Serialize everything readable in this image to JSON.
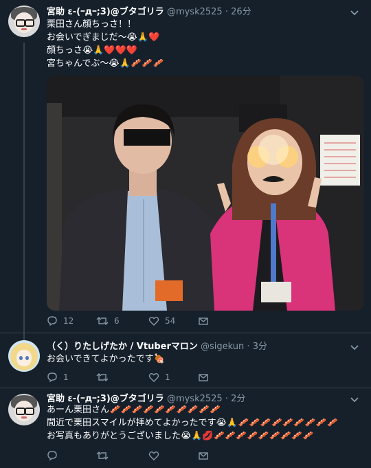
{
  "tweets": [
    {
      "name": "宮助 ε-(ｰдｰ;3)@ブタゴリラ",
      "handle": "@mysk2525",
      "sep": "·",
      "time": "26分",
      "lines": [
        "栗田さん顔ちっさ！！",
        "お会いでぎまじだ〜😭🙏❤️",
        "顔ちっさ😭🙏❤️❤️❤️",
        "宮ちゃんでぶ〜😭🙏🥓🥓🥓"
      ],
      "reply_count": "12",
      "retweet_count": "6",
      "like_count": "54"
    },
    {
      "name": "（く）りたしげたか / Vtuberマロン",
      "handle": "@sigekun",
      "sep": "·",
      "time": "3分",
      "lines": [
        "お会いできてよかったです🍖"
      ],
      "reply_count": "1",
      "retweet_count": "",
      "like_count": "1"
    },
    {
      "name": "宮助 ε-(ｰдｰ;3)@ブタゴリラ",
      "handle": "@mysk2525",
      "sep": "·",
      "time": "2分",
      "lines": [
        "あーん栗田さん🥓🥓🥓🥓🥓🥓🥓🥓🥓🥓",
        "間近で栗田スマイルが拝めてよかったです😭🙏🥓🥓🥓🥓🥓🥓🥓🥓🥓",
        "お写真もありがとうございました😭🙏💋🥓🥓🥓🥓🥓🥓🥓🥓🥓"
      ],
      "reply_count": "",
      "retweet_count": "",
      "like_count": ""
    }
  ],
  "icons": {
    "reply": "reply-icon",
    "retweet": "retweet-icon",
    "like": "heart-icon",
    "share": "share-icon",
    "more": "chevron-down-icon"
  },
  "colors": {
    "background": "#15202b",
    "divider": "#38444d",
    "muted": "#8899a6",
    "text": "#ffffff"
  }
}
